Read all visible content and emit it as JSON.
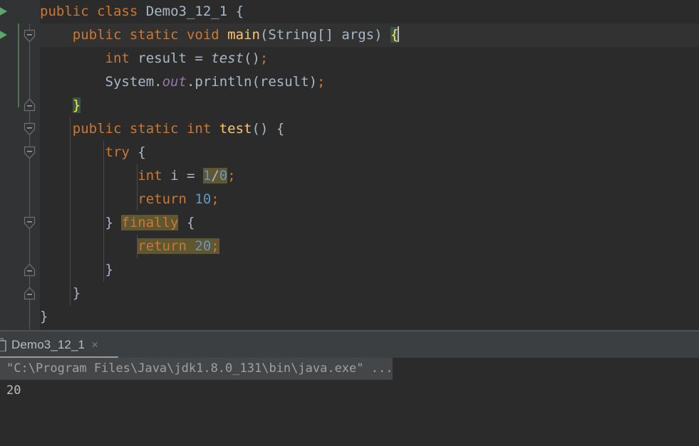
{
  "app": {
    "theme": "Darcula",
    "colors": {
      "editor_bg": "#2b2b2b",
      "gutter_bg": "#313335",
      "caret_line": "#323232",
      "keyword": "#cc7832",
      "identifier": "#a9b7c6",
      "method": "#ffc66d",
      "number": "#6897bb",
      "static_field": "#9876aa",
      "usage_highlight": "#5f5632",
      "bracket_match_bg": "#3b514d",
      "bracket_match_fg": "#ffef28",
      "run_arrow_green": "#59a869",
      "vcs_change_green": "#6a8759",
      "panel_bg": "#3c3f41",
      "console_cmd_bg": "#444648"
    }
  },
  "editor": {
    "file": "Demo3_12_1",
    "language": "Java",
    "caret_line_number": 2,
    "lines": [
      {
        "n": 1,
        "indent": 0,
        "run_arrow": true,
        "fold": null,
        "tokens": [
          {
            "t": "public",
            "c": "kw"
          },
          {
            "t": " ",
            "c": "id"
          },
          {
            "t": "class",
            "c": "kw"
          },
          {
            "t": " ",
            "c": "id"
          },
          {
            "t": "Demo3_12_1",
            "c": "id"
          },
          {
            "t": " ",
            "c": "id"
          },
          {
            "t": "{",
            "c": "br"
          }
        ]
      },
      {
        "n": 2,
        "indent": 1,
        "run_arrow": true,
        "fold": "start",
        "caret_line": true,
        "tokens": [
          {
            "t": "public",
            "c": "kw"
          },
          {
            "t": " ",
            "c": "id"
          },
          {
            "t": "static",
            "c": "kw"
          },
          {
            "t": " ",
            "c": "id"
          },
          {
            "t": "void",
            "c": "kw"
          },
          {
            "t": " ",
            "c": "id"
          },
          {
            "t": "main",
            "c": "mth"
          },
          {
            "t": "(",
            "c": "br"
          },
          {
            "t": "String",
            "c": "id"
          },
          {
            "t": "[] ",
            "c": "br"
          },
          {
            "t": "args",
            "c": "id"
          },
          {
            "t": ") ",
            "c": "br"
          },
          {
            "t": "{",
            "c": "brmatch"
          },
          {
            "t": "",
            "c": "caret"
          }
        ]
      },
      {
        "n": 3,
        "indent": 2,
        "run_arrow": false,
        "fold": null,
        "tokens": [
          {
            "t": "int",
            "c": "kw"
          },
          {
            "t": " result ",
            "c": "id"
          },
          {
            "t": "=",
            "c": "id"
          },
          {
            "t": " ",
            "c": "id"
          },
          {
            "t": "test",
            "c": "loc"
          },
          {
            "t": "()",
            "c": "br"
          },
          {
            "t": ";",
            "c": "semi"
          }
        ]
      },
      {
        "n": 4,
        "indent": 2,
        "run_arrow": false,
        "fold": null,
        "tokens": [
          {
            "t": "System",
            "c": "id"
          },
          {
            "t": ".",
            "c": "br"
          },
          {
            "t": "out",
            "c": "fld"
          },
          {
            "t": ".",
            "c": "br"
          },
          {
            "t": "println",
            "c": "id"
          },
          {
            "t": "(",
            "c": "br"
          },
          {
            "t": "result",
            "c": "id"
          },
          {
            "t": ")",
            "c": "br"
          },
          {
            "t": ";",
            "c": "semi"
          }
        ]
      },
      {
        "n": 5,
        "indent": 1,
        "run_arrow": false,
        "fold": "end",
        "tokens": [
          {
            "t": "}",
            "c": "brmatch"
          }
        ]
      },
      {
        "n": 6,
        "indent": 1,
        "run_arrow": false,
        "fold": "start",
        "tokens": [
          {
            "t": "public",
            "c": "kw"
          },
          {
            "t": " ",
            "c": "id"
          },
          {
            "t": "static",
            "c": "kw"
          },
          {
            "t": " ",
            "c": "id"
          },
          {
            "t": "int",
            "c": "kw"
          },
          {
            "t": " ",
            "c": "id"
          },
          {
            "t": "test",
            "c": "mth"
          },
          {
            "t": "() ",
            "c": "br"
          },
          {
            "t": "{",
            "c": "br"
          }
        ]
      },
      {
        "n": 7,
        "indent": 2,
        "run_arrow": false,
        "fold": "start",
        "tokens": [
          {
            "t": "try",
            "c": "kw"
          },
          {
            "t": " ",
            "c": "id"
          },
          {
            "t": "{",
            "c": "br"
          }
        ]
      },
      {
        "n": 8,
        "indent": 3,
        "run_arrow": false,
        "fold": null,
        "tokens": [
          {
            "t": "int",
            "c": "kw"
          },
          {
            "t": " ",
            "c": "id"
          },
          {
            "t": "i",
            "c": "id"
          },
          {
            "t": " ",
            "c": "id"
          },
          {
            "t": "=",
            "c": "id"
          },
          {
            "t": " ",
            "c": "id"
          },
          {
            "t": "1",
            "c": "num hl"
          },
          {
            "t": "/",
            "c": "id hl"
          },
          {
            "t": "0",
            "c": "num hl"
          },
          {
            "t": ";",
            "c": "semi"
          }
        ]
      },
      {
        "n": 9,
        "indent": 3,
        "run_arrow": false,
        "fold": null,
        "tokens": [
          {
            "t": "return",
            "c": "kw"
          },
          {
            "t": " ",
            "c": "id"
          },
          {
            "t": "10",
            "c": "num"
          },
          {
            "t": ";",
            "c": "semi"
          }
        ]
      },
      {
        "n": 10,
        "indent": 2,
        "run_arrow": false,
        "fold": "start",
        "tokens": [
          {
            "t": "} ",
            "c": "br"
          },
          {
            "t": "finally",
            "c": "kw hl"
          },
          {
            "t": " ",
            "c": "id"
          },
          {
            "t": "{",
            "c": "br"
          }
        ]
      },
      {
        "n": 11,
        "indent": 3,
        "run_arrow": false,
        "fold": null,
        "tokens": [
          {
            "t": "return",
            "c": "kw hl"
          },
          {
            "t": " ",
            "c": "id hl"
          },
          {
            "t": "20",
            "c": "num hl"
          },
          {
            "t": ";",
            "c": "semi hl"
          }
        ]
      },
      {
        "n": 12,
        "indent": 2,
        "run_arrow": false,
        "fold": null,
        "tokens": [
          {
            "t": "}",
            "c": "br"
          }
        ]
      },
      {
        "n": 13,
        "indent": 1,
        "run_arrow": false,
        "fold": "end",
        "tokens": [
          {
            "t": "}",
            "c": "br"
          }
        ]
      },
      {
        "n": 14,
        "indent": 0,
        "run_arrow": false,
        "fold": "end",
        "tokens": [
          {
            "t": "}",
            "c": "br"
          }
        ]
      }
    ]
  },
  "run_window": {
    "tab": {
      "label": "Demo3_12_1",
      "close_label": "×",
      "active": true
    },
    "console": {
      "command_line": "\"C:\\Program Files\\Java\\jdk1.8.0_131\\bin\\java.exe\" ...",
      "output": "20"
    }
  }
}
